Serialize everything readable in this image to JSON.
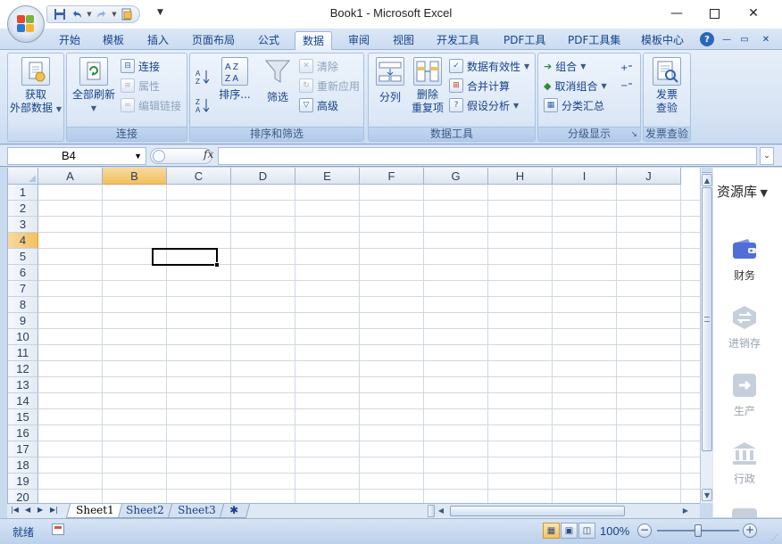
{
  "window": {
    "title": "Book1 - Microsoft Excel",
    "controls": [
      "minimize-icon",
      "maximize-icon",
      "close-icon"
    ]
  },
  "quick_access": [
    "save-icon",
    "undo-icon",
    "redo-icon",
    "new-document-icon",
    "customize-qat-icon"
  ],
  "ribbon": {
    "tabs": [
      {
        "label": "开始"
      },
      {
        "label": "模板"
      },
      {
        "label": "插入"
      },
      {
        "label": "页面布局"
      },
      {
        "label": "公式"
      },
      {
        "label": "数据",
        "active": true
      },
      {
        "label": "审阅"
      },
      {
        "label": "视图"
      },
      {
        "label": "开发工具"
      },
      {
        "label": "PDF工具"
      },
      {
        "label": "PDF工具集"
      },
      {
        "label": "模板中心"
      }
    ],
    "groups": {
      "external": {
        "btn_line1": "获取",
        "btn_line2": "外部数据"
      },
      "connections": {
        "label": "连接",
        "refresh_all": "全部刷新",
        "connections": "连接",
        "properties": "属性",
        "edit_links": "编辑链接"
      },
      "sort_filter": {
        "label": "排序和筛选",
        "sort": "排序...",
        "filter": "筛选",
        "clear": "清除",
        "reapply": "重新应用",
        "advanced": "高级"
      },
      "data_tools": {
        "label": "数据工具",
        "text_to_columns": "分列",
        "remove_dup_line1": "删除",
        "remove_dup_line2": "重复项",
        "validation": "数据有效性",
        "consolidate": "合并计算",
        "what_if": "假设分析"
      },
      "outline": {
        "label": "分级显示",
        "group": "组合",
        "ungroup": "取消组合",
        "subtotal": "分类汇总"
      },
      "invoice": {
        "label": "发票查验",
        "btn_line1": "发票",
        "btn_line2": "查验"
      }
    }
  },
  "formula_bar": {
    "name_box": "B4",
    "fx": "fx",
    "formula": ""
  },
  "grid": {
    "columns": [
      "A",
      "B",
      "C",
      "D",
      "E",
      "F",
      "G",
      "H",
      "I",
      "J"
    ],
    "rows": [
      "1",
      "2",
      "3",
      "4",
      "5",
      "6",
      "7",
      "8",
      "9",
      "10",
      "11",
      "12",
      "13",
      "14",
      "15",
      "16",
      "17",
      "18",
      "19",
      "20"
    ],
    "selected_column": "B",
    "selected_row": "4"
  },
  "side_panel": {
    "title": "资源库",
    "items": [
      {
        "label": "财务",
        "icon": "wallet-icon",
        "color": "#4f6fd6"
      },
      {
        "label": "进销存",
        "icon": "exchange-icon",
        "color": "#c6cfdc"
      },
      {
        "label": "生产",
        "icon": "arrow-right-icon",
        "color": "#c6cfdc"
      },
      {
        "label": "行政",
        "icon": "bank-icon",
        "color": "#c6cfdc"
      }
    ]
  },
  "sheets": [
    {
      "label": "Sheet1",
      "active": true
    },
    {
      "label": "Sheet2"
    },
    {
      "label": "Sheet3"
    }
  ],
  "status": {
    "ready": "就绪",
    "zoom": "100%",
    "zoom_out": "−",
    "zoom_in": "+"
  }
}
